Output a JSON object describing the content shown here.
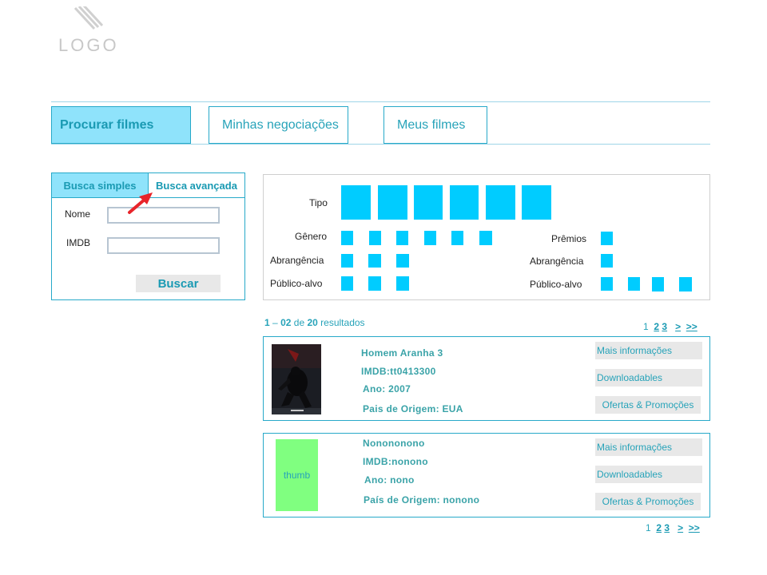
{
  "logo": {
    "text": "LOGO",
    "icon": "logo-stripes-icon"
  },
  "nav_tabs": [
    {
      "label": "Procurar filmes",
      "active": true
    },
    {
      "label": "Minhas negociações",
      "active": false
    },
    {
      "label": "Meus filmes",
      "active": false
    }
  ],
  "search": {
    "tabs": [
      "Busca simples",
      "Busca avançada"
    ],
    "fields": [
      {
        "label": "Nome",
        "value": ""
      },
      {
        "label": "IMDB",
        "value": ""
      }
    ],
    "button": "Buscar"
  },
  "filters": {
    "left": [
      "Tipo",
      "Gênero",
      "Abrangência",
      "Público-alvo"
    ],
    "right": [
      "Prêmios",
      "Abrangência",
      "Público-alvo"
    ]
  },
  "results": {
    "summary": {
      "from": "1",
      "sep": "–",
      "to": "02",
      "of": "de",
      "total": "20",
      "word": "resultados"
    },
    "pager": {
      "current": "1",
      "pages": [
        "2",
        "3"
      ],
      "next": ">",
      "last": ">>"
    },
    "items": [
      {
        "thumb": "poster",
        "title": "Homem Aranha 3",
        "imdb": "IMDB:tt0413300",
        "year": "Ano: 2007",
        "country": "Pais de Origem: EUA",
        "actions": [
          "Mais informações",
          "Downloadables",
          "Ofertas & Promoções"
        ]
      },
      {
        "thumb": "thumb",
        "title": "Nonononono",
        "imdb": "IMDB:nonono",
        "year": "Ano: nono",
        "country": "País de Origem: nonono",
        "actions": [
          "Mais informações",
          "Downloadables",
          "Ofertas & Promoções"
        ]
      }
    ]
  },
  "colors": {
    "accent": "#27a9c9",
    "tab_active_bg": "#8fe3fb",
    "filter_square": "#00ccff",
    "thumb_placeholder": "#80ff80",
    "arrow": "#e8242a"
  }
}
